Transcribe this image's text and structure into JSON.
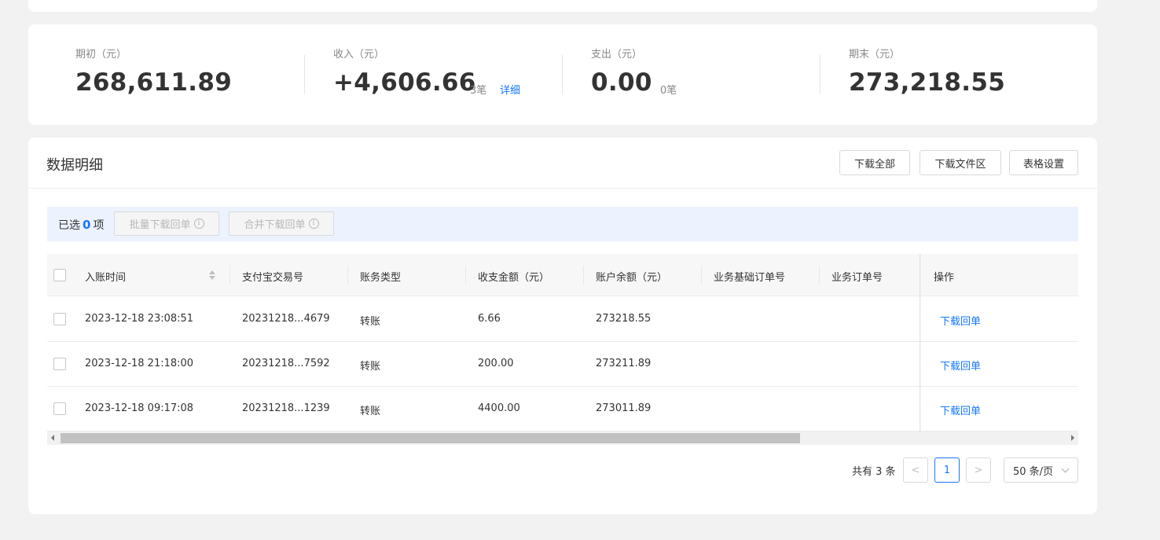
{
  "summary": {
    "opening": {
      "label": "期初（元）",
      "value": "268,611.89"
    },
    "income": {
      "label": "收入（元）",
      "value": "+4,606.66",
      "count": "3笔",
      "detail_link": "详细"
    },
    "expense": {
      "label": "支出（元）",
      "value": "0.00",
      "count": "0笔"
    },
    "closing": {
      "label": "期末（元）",
      "value": "273,218.55"
    }
  },
  "detail": {
    "title": "数据明细",
    "buttons": {
      "download_all": "下载全部",
      "download_files": "下载文件区",
      "table_settings": "表格设置"
    }
  },
  "selection": {
    "prefix": "已选",
    "count": "0",
    "suffix": "项",
    "batch_download": "批量下载回单",
    "merge_download": "合并下载回单",
    "info_glyph": "i"
  },
  "table": {
    "columns": [
      "入账时间",
      "支付宝交易号",
      "账务类型",
      "收支金额（元）",
      "账户余额（元）",
      "业务基础订单号",
      "业务订单号",
      "操作"
    ],
    "rows": [
      {
        "time": "2023-12-18 23:08:51",
        "trade_no": "20231218...4679",
        "type": "转账",
        "amount": "6.66",
        "balance": "273218.55",
        "base_order": "",
        "order": "",
        "action": "下载回单"
      },
      {
        "time": "2023-12-18 21:18:00",
        "trade_no": "20231218...7592",
        "type": "转账",
        "amount": "200.00",
        "balance": "273211.89",
        "base_order": "",
        "order": "",
        "action": "下载回单"
      },
      {
        "time": "2023-12-18 09:17:08",
        "trade_no": "20231218...1239",
        "type": "转账",
        "amount": "4400.00",
        "balance": "273011.89",
        "base_order": "",
        "order": "",
        "action": "下载回单"
      }
    ]
  },
  "pagination": {
    "total": "共有 3 条",
    "prev_glyph": "<",
    "current_page": "1",
    "next_glyph": ">",
    "page_size": "50 条/页"
  },
  "colors": {
    "accent": "#1677ff",
    "selection_bar": "#ecf3fe",
    "background": "#f2f2f2"
  }
}
